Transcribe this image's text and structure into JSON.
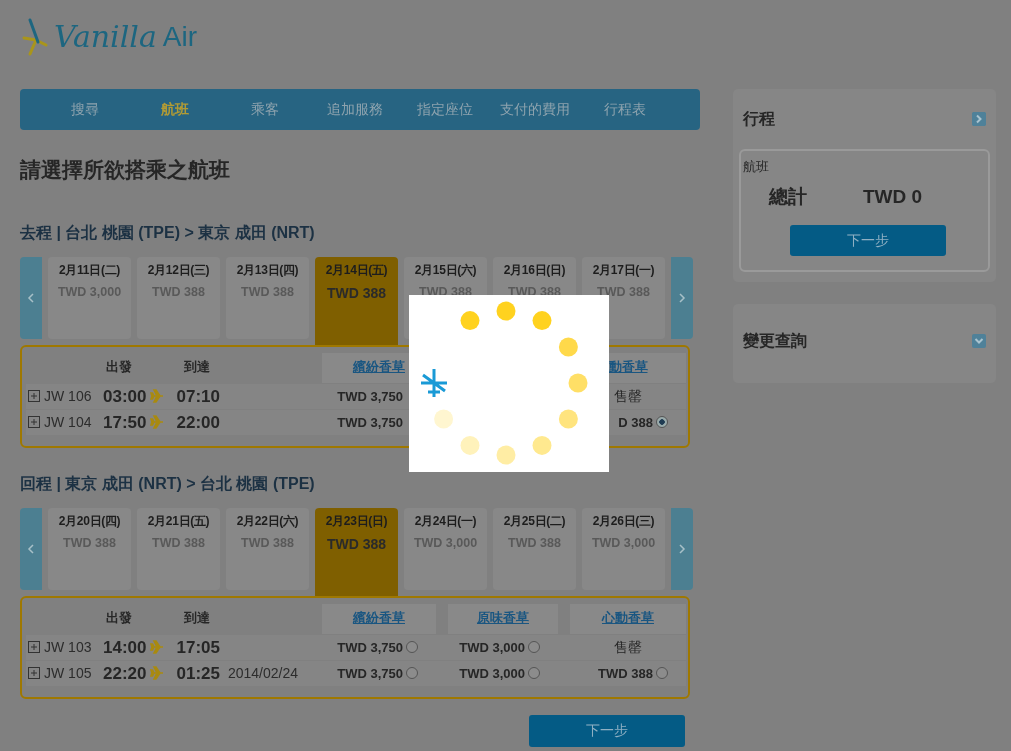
{
  "logo": {
    "brand": "Vanilla",
    "suffix": "Air"
  },
  "steps": [
    {
      "label": "搜尋",
      "selected": false
    },
    {
      "label": "航班",
      "selected": true
    },
    {
      "label": "乘客",
      "selected": false
    },
    {
      "label": "追加服務",
      "selected": false
    },
    {
      "label": "指定座位",
      "selected": false
    },
    {
      "label": "支付的費用",
      "selected": false
    },
    {
      "label": "行程表",
      "selected": false
    }
  ],
  "heading": "請選擇所欲搭乘之航班",
  "trips": [
    {
      "title": "去程 | 台北 桃園 (TPE) > 東京 成田 (NRT)",
      "dates": [
        {
          "date": "2月11日(二)",
          "price": "TWD 3,000",
          "selected": false
        },
        {
          "date": "2月12日(三)",
          "price": "TWD 388",
          "selected": false
        },
        {
          "date": "2月13日(四)",
          "price": "TWD 388",
          "selected": false
        },
        {
          "date": "2月14日(五)",
          "price": "TWD 388",
          "selected": true
        },
        {
          "date": "2月15日(六)",
          "price": "TWD 388",
          "selected": false
        },
        {
          "date": "2月16日(日)",
          "price": "TWD 388",
          "selected": false
        },
        {
          "date": "2月17日(一)",
          "price": "TWD 388",
          "selected": false
        }
      ],
      "depart_label": "出發",
      "arrive_label": "到達",
      "fare_columns": {
        "column_1": {
          "name": "繽紛香草"
        },
        "column_3": {
          "name": "動香草"
        }
      },
      "flights": [
        {
          "flight": "JW 106",
          "depart": "03:00",
          "arrive": "07:10",
          "fares": {
            "column_1": {
              "kind": "fare",
              "price": "TWD 3,750"
            },
            "column_3": {
              "kind": "sold_out",
              "text": "售罄"
            }
          }
        },
        {
          "flight": "JW 104",
          "depart": "17:50",
          "arrive": "22:00",
          "fares": {
            "column_1": {
              "kind": "fare",
              "price": "TWD 3,750"
            },
            "column_3": {
              "kind": "fare",
              "price": "D 388",
              "selected": true
            }
          }
        }
      ]
    },
    {
      "title": "回程 | 東京 成田 (NRT) > 台北 桃園 (TPE)",
      "dates": [
        {
          "date": "2月20日(四)",
          "price": "TWD 388",
          "selected": false
        },
        {
          "date": "2月21日(五)",
          "price": "TWD 388",
          "selected": false
        },
        {
          "date": "2月22日(六)",
          "price": "TWD 388",
          "selected": false
        },
        {
          "date": "2月23日(日)",
          "price": "TWD 388",
          "selected": true
        },
        {
          "date": "2月24日(一)",
          "price": "TWD 3,000",
          "selected": false
        },
        {
          "date": "2月25日(二)",
          "price": "TWD 388",
          "selected": false
        },
        {
          "date": "2月26日(三)",
          "price": "TWD 3,000",
          "selected": false
        }
      ],
      "depart_label": "出發",
      "arrive_label": "到達",
      "fare_columns": {
        "column_1": {
          "name": "繽紛香草"
        },
        "column_2": {
          "name": "原味香草"
        },
        "column_3": {
          "name": "心動香草"
        }
      },
      "flights": [
        {
          "flight": "JW 103",
          "depart": "14:00",
          "arrive": "17:05",
          "fares": {
            "column_1": {
              "kind": "fare",
              "price": "TWD 3,750",
              "selected": false
            },
            "column_2": {
              "kind": "fare",
              "price": "TWD 3,000",
              "selected": false
            },
            "column_3": {
              "kind": "sold_out",
              "text": "售罄"
            }
          }
        },
        {
          "flight": "JW 105",
          "depart": "22:20",
          "arrive": "01:25",
          "arrive_note": "2014/02/24",
          "fares": {
            "column_1": {
              "kind": "fare",
              "price": "TWD 3,750",
              "selected": false
            },
            "column_2": {
              "kind": "fare",
              "price": "TWD 3,000",
              "selected": false
            },
            "column_3": {
              "kind": "fare",
              "price": "TWD 388",
              "selected": false
            }
          }
        }
      ]
    }
  ],
  "next_button": "下一步",
  "sidebar": {
    "itinerary": {
      "title": "行程",
      "flight_label": "航班",
      "total_label": "總計",
      "total": "TWD 0",
      "button": "下一步"
    },
    "change": {
      "title": "變更查詢"
    }
  }
}
